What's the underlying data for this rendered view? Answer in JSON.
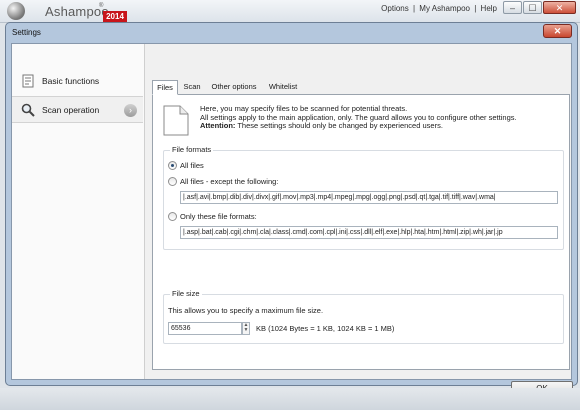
{
  "app": {
    "brand": "Ashampoo",
    "reg_mark": "®",
    "year": "2014",
    "links": [
      "Options",
      "|",
      "My Ashampoo",
      "|",
      "Help"
    ]
  },
  "dialog": {
    "title": "Settings",
    "close_glyph": "✕"
  },
  "sidebar": {
    "items": [
      {
        "label": "Basic functions",
        "icon": "basic-functions-icon"
      },
      {
        "label": "Scan operation",
        "icon": "magnifier-icon"
      }
    ]
  },
  "tabs": [
    "Files",
    "Scan",
    "Other options",
    "Whitelist"
  ],
  "intro": {
    "line1": "Here, you may specify files to be scanned for potential threats.",
    "line2": "All settings apply to the main application, only. The guard allows you to configure other settings.",
    "attention_label": "Attention:",
    "attention_text": " These settings should only be changed by experienced users."
  },
  "file_formats": {
    "title": "File formats",
    "options": [
      {
        "label": "All files",
        "selected": true
      },
      {
        "label": "All files - except the following:",
        "selected": false
      },
      {
        "label": "Only these file formats:",
        "selected": false
      }
    ],
    "except_value": "|.asf|.avi|.bmp|.dib|.div|.divx|.gif|.mov|.mp3|.mp4|.mpeg|.mpg|.ogg|.png|.psd|.qt|.tga|.tif|.tiff|.wav|.wma|",
    "only_value": "|.asp|.bat|.cab|.cgi|.chm|.cla|.class|.cmd|.com|.cpl|.ini|.css|.dll|.elf|.exe|.hlp|.hta|.htm|.html|.zip|.wh|.jar|.jp"
  },
  "file_size": {
    "title": "File size",
    "description": "This allows you to specify a maximum file size.",
    "value": "65536",
    "unit": "KB (1024 Bytes = 1 KB, 1024 KB = 1 MB)"
  },
  "buttons": {
    "ok": "OK",
    "minimize": "–",
    "maximize": "☐",
    "close": "✕"
  },
  "colors": {
    "dialog_frame": "#b4c7dd",
    "close_red": "#c8462f",
    "brand_red": "#c8151b"
  }
}
